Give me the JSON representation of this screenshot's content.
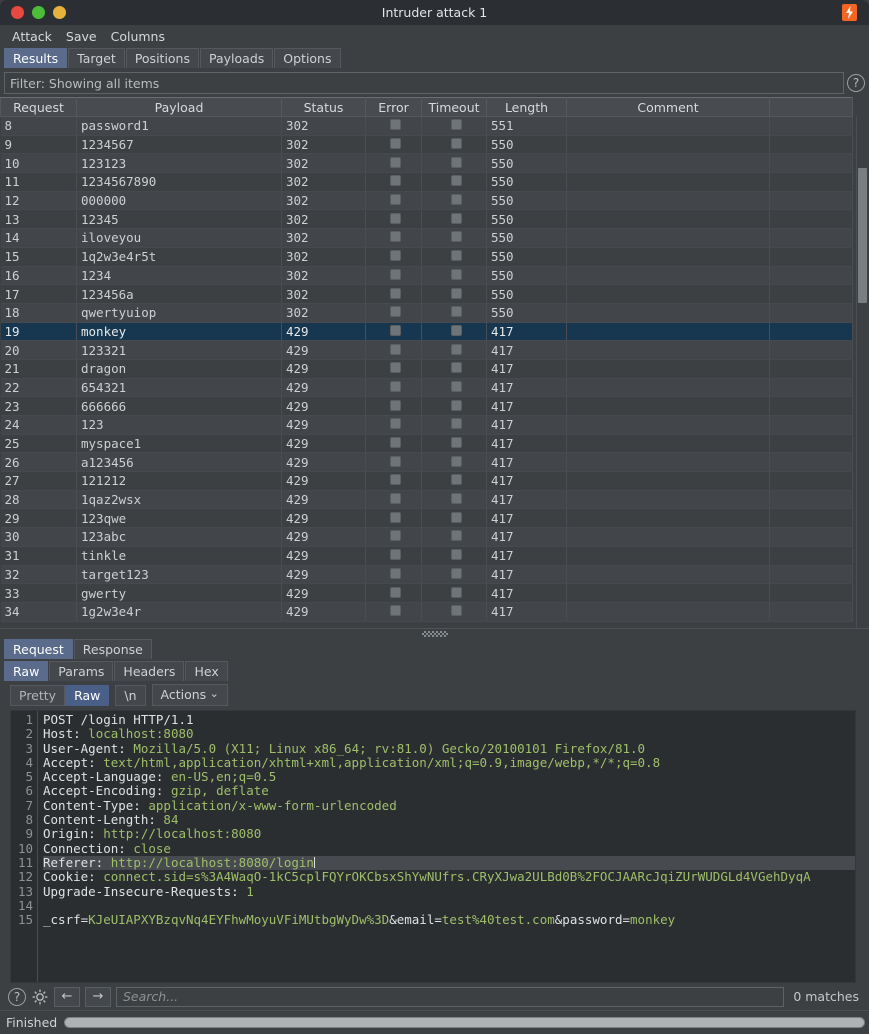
{
  "window": {
    "title": "Intruder attack 1",
    "logo_icon": "burp-logo-icon",
    "close_icon": "close-window-icon",
    "minimize_icon": "minimize-window-icon",
    "maximize_icon": "maximize-window-icon"
  },
  "menubar": {
    "items": [
      "Attack",
      "Save",
      "Columns"
    ]
  },
  "main_tabs": {
    "active": "Results",
    "items": [
      "Results",
      "Target",
      "Positions",
      "Payloads",
      "Options"
    ]
  },
  "filter": {
    "text": "Filter: Showing all items",
    "help_icon": "question-mark-icon",
    "help_label": "?"
  },
  "results_table": {
    "columns": [
      "Request",
      "Payload",
      "Status",
      "Error",
      "Timeout",
      "Length",
      "Comment"
    ],
    "selected_request": "19",
    "rows": [
      {
        "request": "8",
        "payload": "password1",
        "status": "302",
        "error": false,
        "timeout": false,
        "length": "551",
        "comment": ""
      },
      {
        "request": "9",
        "payload": "1234567",
        "status": "302",
        "error": false,
        "timeout": false,
        "length": "550",
        "comment": ""
      },
      {
        "request": "10",
        "payload": "123123",
        "status": "302",
        "error": false,
        "timeout": false,
        "length": "550",
        "comment": ""
      },
      {
        "request": "11",
        "payload": "1234567890",
        "status": "302",
        "error": false,
        "timeout": false,
        "length": "550",
        "comment": ""
      },
      {
        "request": "12",
        "payload": "000000",
        "status": "302",
        "error": false,
        "timeout": false,
        "length": "550",
        "comment": ""
      },
      {
        "request": "13",
        "payload": "12345",
        "status": "302",
        "error": false,
        "timeout": false,
        "length": "550",
        "comment": ""
      },
      {
        "request": "14",
        "payload": "iloveyou",
        "status": "302",
        "error": false,
        "timeout": false,
        "length": "550",
        "comment": ""
      },
      {
        "request": "15",
        "payload": "1q2w3e4r5t",
        "status": "302",
        "error": false,
        "timeout": false,
        "length": "550",
        "comment": ""
      },
      {
        "request": "16",
        "payload": "1234",
        "status": "302",
        "error": false,
        "timeout": false,
        "length": "550",
        "comment": ""
      },
      {
        "request": "17",
        "payload": "123456a",
        "status": "302",
        "error": false,
        "timeout": false,
        "length": "550",
        "comment": ""
      },
      {
        "request": "18",
        "payload": "qwertyuiop",
        "status": "302",
        "error": false,
        "timeout": false,
        "length": "550",
        "comment": ""
      },
      {
        "request": "19",
        "payload": "monkey",
        "status": "429",
        "error": false,
        "timeout": false,
        "length": "417",
        "comment": ""
      },
      {
        "request": "20",
        "payload": "123321",
        "status": "429",
        "error": false,
        "timeout": false,
        "length": "417",
        "comment": ""
      },
      {
        "request": "21",
        "payload": "dragon",
        "status": "429",
        "error": false,
        "timeout": false,
        "length": "417",
        "comment": ""
      },
      {
        "request": "22",
        "payload": "654321",
        "status": "429",
        "error": false,
        "timeout": false,
        "length": "417",
        "comment": ""
      },
      {
        "request": "23",
        "payload": "666666",
        "status": "429",
        "error": false,
        "timeout": false,
        "length": "417",
        "comment": ""
      },
      {
        "request": "24",
        "payload": "123",
        "status": "429",
        "error": false,
        "timeout": false,
        "length": "417",
        "comment": ""
      },
      {
        "request": "25",
        "payload": "myspace1",
        "status": "429",
        "error": false,
        "timeout": false,
        "length": "417",
        "comment": ""
      },
      {
        "request": "26",
        "payload": "a123456",
        "status": "429",
        "error": false,
        "timeout": false,
        "length": "417",
        "comment": ""
      },
      {
        "request": "27",
        "payload": "121212",
        "status": "429",
        "error": false,
        "timeout": false,
        "length": "417",
        "comment": ""
      },
      {
        "request": "28",
        "payload": "1qaz2wsx",
        "status": "429",
        "error": false,
        "timeout": false,
        "length": "417",
        "comment": ""
      },
      {
        "request": "29",
        "payload": "123qwe",
        "status": "429",
        "error": false,
        "timeout": false,
        "length": "417",
        "comment": ""
      },
      {
        "request": "30",
        "payload": "123abc",
        "status": "429",
        "error": false,
        "timeout": false,
        "length": "417",
        "comment": ""
      },
      {
        "request": "31",
        "payload": "tinkle",
        "status": "429",
        "error": false,
        "timeout": false,
        "length": "417",
        "comment": ""
      },
      {
        "request": "32",
        "payload": "target123",
        "status": "429",
        "error": false,
        "timeout": false,
        "length": "417",
        "comment": ""
      },
      {
        "request": "33",
        "payload": "gwerty",
        "status": "429",
        "error": false,
        "timeout": false,
        "length": "417",
        "comment": ""
      },
      {
        "request": "34",
        "payload": "1g2w3e4r",
        "status": "429",
        "error": false,
        "timeout": false,
        "length": "417",
        "comment": ""
      }
    ]
  },
  "message_tabs": {
    "active": "Request",
    "items": [
      "Request",
      "Response"
    ]
  },
  "view_tabs": {
    "active": "Raw",
    "items": [
      "Raw",
      "Params",
      "Headers",
      "Hex"
    ]
  },
  "editor_toolbar": {
    "pretty_label": "Pretty",
    "raw_label": "Raw",
    "newline_label": "\\n",
    "actions_label": "Actions",
    "active_view": "Raw",
    "chevron_icon": "chevron-down-icon"
  },
  "request_editor": {
    "highlighted_line": 11,
    "lines": [
      {
        "n": "1",
        "key": "POST /login HTTP/1.1",
        "val": ""
      },
      {
        "n": "2",
        "key": "Host:",
        "val": " localhost:8080"
      },
      {
        "n": "3",
        "key": "User-Agent:",
        "val": " Mozilla/5.0 (X11; Linux x86_64; rv:81.0) Gecko/20100101 Firefox/81.0"
      },
      {
        "n": "4",
        "key": "Accept:",
        "val": " text/html,application/xhtml+xml,application/xml;q=0.9,image/webp,*/*;q=0.8"
      },
      {
        "n": "5",
        "key": "Accept-Language:",
        "val": " en-US,en;q=0.5"
      },
      {
        "n": "6",
        "key": "Accept-Encoding:",
        "val": " gzip, deflate"
      },
      {
        "n": "7",
        "key": "Content-Type:",
        "val": " application/x-www-form-urlencoded"
      },
      {
        "n": "8",
        "key": "Content-Length:",
        "val": " 84"
      },
      {
        "n": "9",
        "key": "Origin:",
        "val": " http://localhost:8080"
      },
      {
        "n": "10",
        "key": "Connection:",
        "val": " close"
      },
      {
        "n": "11",
        "key": "Referer:",
        "val": " http://localhost:8080/login"
      },
      {
        "n": "12",
        "key": "Cookie:",
        "val": " connect.sid=s%3A4WaqO-1kC5cplFQYrOKCbsxShYwNUfrs.CRyXJwa2ULBd0B%2FOCJAARcJqiZUrWUDGLd4VGehDyqA"
      },
      {
        "n": "13",
        "key": "Upgrade-Insecure-Requests:",
        "val": " 1"
      },
      {
        "n": "14",
        "key": "",
        "val": ""
      },
      {
        "n": "15",
        "key": "_csrf=",
        "val": "KJeUIAPXYBzqvNq4EYFhwMoyuVFiMUtbgWyDw%3D",
        "key2": "&email=",
        "val2": "test%40test.com",
        "key3": "&password=",
        "val3": "monkey"
      }
    ]
  },
  "search": {
    "placeholder": "Search...",
    "value": "",
    "matches_label": "0 matches",
    "help_icon": "question-mark-icon",
    "help_label": "?",
    "settings_icon": "gear-icon",
    "prev_icon": "arrow-left-icon",
    "prev_label": "←",
    "next_icon": "arrow-right-icon",
    "next_label": "→"
  },
  "statusbar": {
    "text": "Finished",
    "progress_percent": 100
  },
  "colors": {
    "accent": "#4a5f88",
    "selection": "#16374f",
    "brand": "#f26522",
    "value_text": "#9fbf6a",
    "window_bg": "#3c4043"
  }
}
